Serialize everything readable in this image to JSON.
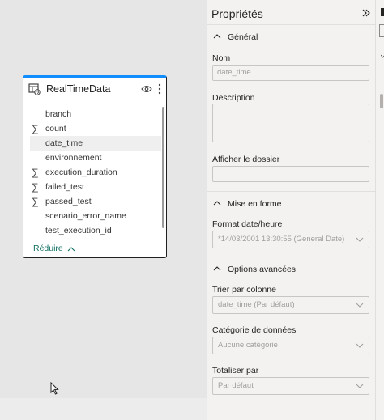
{
  "card": {
    "title": "RealTimeData",
    "fields": [
      {
        "name": "branch",
        "sigma": ""
      },
      {
        "name": "count",
        "sigma": "∑"
      },
      {
        "name": "date_time",
        "sigma": "",
        "selected": true
      },
      {
        "name": "environnement",
        "sigma": ""
      },
      {
        "name": "execution_duration",
        "sigma": "∑"
      },
      {
        "name": "failed_test",
        "sigma": "∑"
      },
      {
        "name": "passed_test",
        "sigma": "∑"
      },
      {
        "name": "scenario_error_name",
        "sigma": ""
      },
      {
        "name": "test_execution_id",
        "sigma": ""
      }
    ],
    "reduce_label": "Réduire"
  },
  "pane": {
    "title": "Propriétés",
    "general": {
      "title": "Général",
      "name_label": "Nom",
      "name_value": "date_time",
      "description_label": "Description",
      "folder_label": "Afficher le dossier"
    },
    "format": {
      "title": "Mise en forme",
      "date_format_label": "Format date/heure",
      "date_format_value": "*14/03/2001 13:30:55 (General Date)"
    },
    "advanced": {
      "title": "Options avancées",
      "sort_label": "Trier par colonne",
      "sort_value": "date_time (Par défaut)",
      "category_label": "Catégorie de données",
      "category_value": "Aucune catégorie",
      "summarize_label": "Totaliser par",
      "summarize_value": "Par défaut"
    }
  },
  "colors": {
    "accent": "#118dff",
    "link": "#0f6f62",
    "pane_bg": "#f3f2f1",
    "canvas_bg": "#e6e6e6"
  }
}
